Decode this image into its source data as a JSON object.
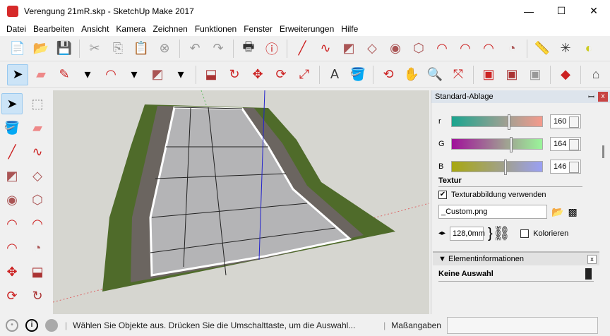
{
  "window": {
    "title": "Verengung 21mR.skp - SketchUp Make 2017",
    "minimize": "—",
    "maximize": "☐",
    "close": "✕"
  },
  "menu": [
    "Datei",
    "Bearbeiten",
    "Ansicht",
    "Kamera",
    "Zeichnen",
    "Funktionen",
    "Fenster",
    "Erweiterungen",
    "Hilfe"
  ],
  "toolbar1": [
    {
      "icon": "new-file-icon",
      "glyph": "📄",
      "color": "#c22"
    },
    {
      "icon": "open-folder-icon",
      "glyph": "📂",
      "color": "#6a5"
    },
    {
      "icon": "save-icon",
      "glyph": "💾",
      "color": "#246"
    },
    {
      "sep": true
    },
    {
      "icon": "cut-icon",
      "glyph": "✂",
      "color": "#999"
    },
    {
      "icon": "copy-icon",
      "glyph": "⎘",
      "color": "#999"
    },
    {
      "icon": "paste-icon",
      "glyph": "📋",
      "color": "#999"
    },
    {
      "icon": "erase-icon",
      "glyph": "⊗",
      "color": "#999"
    },
    {
      "sep": true
    },
    {
      "icon": "undo-icon",
      "glyph": "↶",
      "color": "#999"
    },
    {
      "icon": "redo-icon",
      "glyph": "↷",
      "color": "#999"
    },
    {
      "sep": true
    },
    {
      "icon": "print-icon",
      "glyph": "🖶",
      "color": "#333"
    },
    {
      "icon": "model-info-icon",
      "glyph": "ⓘ",
      "color": "#c22"
    },
    {
      "sep": true
    },
    {
      "icon": "line-icon",
      "glyph": "╱",
      "color": "#c22"
    },
    {
      "icon": "freehand-icon",
      "glyph": "∿",
      "color": "#c22"
    },
    {
      "icon": "rectangle-icon",
      "glyph": "◩",
      "color": "#a55"
    },
    {
      "icon": "rotated-rectangle-icon",
      "glyph": "◇",
      "color": "#a55"
    },
    {
      "icon": "circle-icon",
      "glyph": "◉",
      "color": "#a55"
    },
    {
      "icon": "polygon-icon",
      "glyph": "⬡",
      "color": "#a55"
    },
    {
      "icon": "arc-icon",
      "glyph": "◠",
      "color": "#c22"
    },
    {
      "icon": "arc-2pt-icon",
      "glyph": "◠",
      "color": "#c22"
    },
    {
      "icon": "arc-3pt-icon",
      "glyph": "◠",
      "color": "#c22"
    },
    {
      "icon": "pie-icon",
      "glyph": "◔",
      "color": "#a55"
    },
    {
      "sep": true
    },
    {
      "icon": "tape-measure-icon",
      "glyph": "📏",
      "color": "#cc2"
    },
    {
      "icon": "axes-icon",
      "glyph": "✳",
      "color": "#333"
    },
    {
      "icon": "dimension-icon",
      "glyph": "◐",
      "color": "#cc2"
    }
  ],
  "toolbar2": [
    {
      "icon": "select-icon",
      "glyph": "➤",
      "color": "#000",
      "selected": true
    },
    {
      "icon": "eraser-icon",
      "glyph": "▰",
      "color": "#e88"
    },
    {
      "icon": "pencil-icon",
      "glyph": "✎",
      "color": "#c22"
    },
    {
      "icon": "dropdown-icon",
      "glyph": "▾",
      "color": "#000"
    },
    {
      "icon": "arc-icon",
      "glyph": "◠",
      "color": "#c22"
    },
    {
      "icon": "dropdown-icon",
      "glyph": "▾",
      "color": "#000"
    },
    {
      "icon": "rectangle-icon",
      "glyph": "◩",
      "color": "#a55"
    },
    {
      "icon": "dropdown-icon",
      "glyph": "▾",
      "color": "#000"
    },
    {
      "sep": true
    },
    {
      "icon": "push-pull-icon",
      "glyph": "⬓",
      "color": "#a33"
    },
    {
      "icon": "follow-me-icon",
      "glyph": "↻",
      "color": "#c22"
    },
    {
      "icon": "move-icon",
      "glyph": "✥",
      "color": "#c22"
    },
    {
      "icon": "rotate-icon",
      "glyph": "⟳",
      "color": "#c22"
    },
    {
      "icon": "scale-icon",
      "glyph": "⤢",
      "color": "#c22"
    },
    {
      "sep": true
    },
    {
      "icon": "text-icon",
      "glyph": "A",
      "color": "#333"
    },
    {
      "icon": "paint-bucket-icon",
      "glyph": "🪣",
      "color": "#a80"
    },
    {
      "sep": true
    },
    {
      "icon": "orbit-icon",
      "glyph": "⟲",
      "color": "#c22"
    },
    {
      "icon": "pan-icon",
      "glyph": "✋",
      "color": "#ca8"
    },
    {
      "icon": "zoom-icon",
      "glyph": "🔍",
      "color": "#246"
    },
    {
      "icon": "zoom-extents-icon",
      "glyph": "⤧",
      "color": "#c22"
    },
    {
      "sep": true
    },
    {
      "icon": "3d-warehouse-icon",
      "glyph": "▣",
      "color": "#c22"
    },
    {
      "icon": "extension-warehouse-icon",
      "glyph": "▣",
      "color": "#a33"
    },
    {
      "icon": "share-model-icon",
      "glyph": "▣",
      "color": "#999"
    },
    {
      "sep": true
    },
    {
      "icon": "ruby-icon",
      "glyph": "◆",
      "color": "#c22"
    },
    {
      "sep": true
    },
    {
      "icon": "home-icon",
      "glyph": "⌂",
      "color": "#555"
    }
  ],
  "palette": [
    {
      "icon": "select-icon",
      "glyph": "➤",
      "color": "#000",
      "selected": true
    },
    {
      "icon": "make-component-icon",
      "glyph": "⬚",
      "color": "#888"
    },
    {
      "icon": "paint-bucket-icon",
      "glyph": "🪣",
      "color": "#a80"
    },
    {
      "icon": "eraser-icon",
      "glyph": "▰",
      "color": "#e88"
    },
    {
      "icon": "line-icon",
      "glyph": "╱",
      "color": "#c22"
    },
    {
      "icon": "freehand-icon",
      "glyph": "∿",
      "color": "#c22"
    },
    {
      "icon": "rectangle-icon",
      "glyph": "◩",
      "color": "#a55"
    },
    {
      "icon": "rotated-rectangle-icon",
      "glyph": "◇",
      "color": "#a55"
    },
    {
      "icon": "circle-icon",
      "glyph": "◉",
      "color": "#a55"
    },
    {
      "icon": "polygon-icon",
      "glyph": "⬡",
      "color": "#a55"
    },
    {
      "icon": "arc-icon",
      "glyph": "◠",
      "color": "#c22"
    },
    {
      "icon": "arc-2pt-icon",
      "glyph": "◠",
      "color": "#c22"
    },
    {
      "icon": "arc-3pt-icon",
      "glyph": "◠",
      "color": "#c22"
    },
    {
      "icon": "pie-icon",
      "glyph": "◔",
      "color": "#a55"
    },
    {
      "icon": "move-icon",
      "glyph": "✥",
      "color": "#c22"
    },
    {
      "icon": "push-pull-icon",
      "glyph": "⬓",
      "color": "#a33"
    },
    {
      "icon": "rotate-icon",
      "glyph": "⟳",
      "color": "#c22"
    },
    {
      "icon": "follow-me-icon",
      "glyph": "↻",
      "color": "#a33"
    }
  ],
  "tray": {
    "title": "Standard-Ablage",
    "pin": "ꟷ",
    "close": "x",
    "color_rows": [
      {
        "label": "r",
        "value": "160",
        "from": "#1aa58f",
        "to": "#f59a8c",
        "pos": 0.62
      },
      {
        "label": "G",
        "value": "164",
        "from": "#a0109a",
        "to": "#9af59a",
        "pos": 0.64
      },
      {
        "label": "B",
        "value": "146",
        "from": "#a8a810",
        "to": "#9aa0f5",
        "pos": 0.58
      }
    ],
    "texture_heading": "Textur",
    "use_texture_label": "Texturabbildung verwenden",
    "use_texture_checked": true,
    "texture_file": "_Custom.png",
    "width_value": "128,0mm",
    "colorize_label": "Kolorieren",
    "entity_info_title": "Elementinformationen",
    "entity_info_value": "Keine Auswahl"
  },
  "status": {
    "message": "Wählen Sie Objekte aus. Drücken Sie die Umschalttaste, um die Auswahl...",
    "measurements_label": "Maßangaben",
    "measurements_value": ""
  }
}
